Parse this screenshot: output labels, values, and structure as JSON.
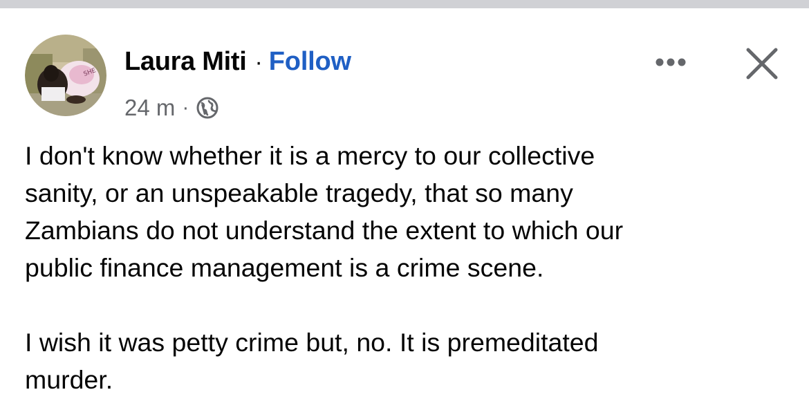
{
  "post": {
    "author_name": "Laura Miti",
    "separator": "·",
    "follow_label": "Follow",
    "timestamp": "24 m",
    "meta_separator": "·",
    "audience_icon": "globe-icon",
    "more_icon": "more-dots-icon",
    "close_icon": "close-icon",
    "paragraph_1_line_1": "I don't know whether it is a mercy to our collective",
    "paragraph_1_line_2": "sanity, or an unspeakable tragedy, that so many",
    "paragraph_1_line_3": "Zambians do not understand the extent to which our",
    "paragraph_1_line_4": "public finance management is a crime scene.",
    "paragraph_2_line_1": "I wish it was petty crime but, no. It is premeditated",
    "paragraph_2_line_2": "murder."
  },
  "colors": {
    "text": "#050505",
    "secondary_text": "#65676b",
    "link": "#1f5fc4",
    "top_strip": "#d0d1d5",
    "background": "#ffffff"
  }
}
